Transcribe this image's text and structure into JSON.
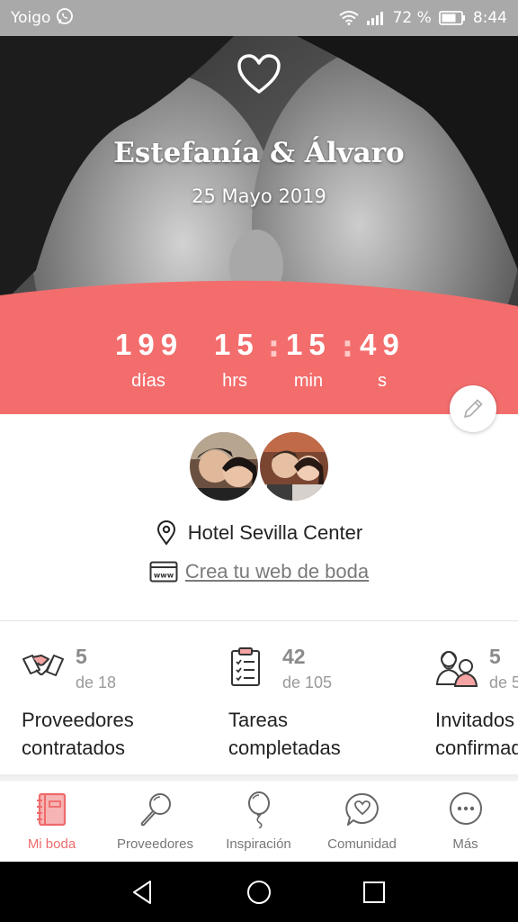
{
  "status_bar": {
    "carrier": "Yoigo",
    "battery_percent": "72 %",
    "time": "8:44"
  },
  "hero": {
    "names": "Estefanía & Álvaro",
    "date": "25 Mayo 2019"
  },
  "countdown": {
    "days": "199",
    "hours": "15",
    "minutes": "15",
    "seconds": "49",
    "separator": ":",
    "days_label": "días",
    "hours_label": "hrs",
    "minutes_label": "min",
    "seconds_label": "s"
  },
  "couple": {
    "venue": "Hotel Sevilla Center",
    "web_link": "Crea tu web de boda"
  },
  "stats": [
    {
      "icon": "handshake-icon",
      "count": "5",
      "total": "de 18",
      "label": "Proveedores\ncontratados"
    },
    {
      "icon": "clipboard-icon",
      "count": "42",
      "total": "de 105",
      "label": "Tareas\ncompletadas"
    },
    {
      "icon": "guests-icon",
      "count": "5",
      "total": "de 5",
      "label": "Invitados\nconfirmados"
    }
  ],
  "tabs": [
    {
      "label": "Mi boda",
      "icon": "notebook-icon",
      "active": true
    },
    {
      "label": "Proveedores",
      "icon": "magnifier-icon",
      "active": false
    },
    {
      "label": "Inspiración",
      "icon": "balloon-icon",
      "active": false
    },
    {
      "label": "Comunidad",
      "icon": "chat-heart-icon",
      "active": false
    },
    {
      "label": "Más",
      "icon": "more-icon",
      "active": false
    }
  ],
  "colors": {
    "accent": "#f36d6d",
    "status_bar": "#a9a9a9",
    "tab_active": "#ef6b6b"
  }
}
